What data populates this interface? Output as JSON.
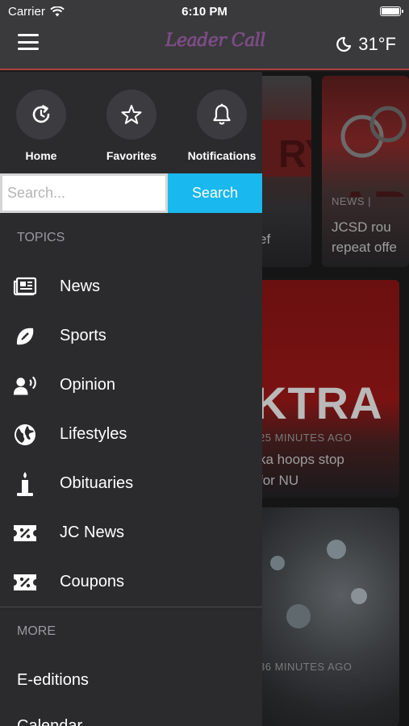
{
  "status_bar": {
    "carrier": "Carrier",
    "time": "6:10 PM"
  },
  "header": {
    "logo_text": "Leader Call",
    "temperature": "31°F",
    "weather_icon": "moon-icon"
  },
  "quick_links": [
    {
      "label": "Home",
      "icon": "refresh-clock-icon"
    },
    {
      "label": "Favorites",
      "icon": "star-icon"
    },
    {
      "label": "Notifications",
      "icon": "bell-icon"
    }
  ],
  "search": {
    "placeholder": "Search...",
    "value": "",
    "button_label": "Search"
  },
  "topics_heading": "TOPICS",
  "topics": [
    {
      "label": "News",
      "icon": "newspaper-icon"
    },
    {
      "label": "Sports",
      "icon": "football-icon"
    },
    {
      "label": "Opinion",
      "icon": "speaking-person-icon"
    },
    {
      "label": "Lifestyles",
      "icon": "globe-icon"
    },
    {
      "label": "Obituaries",
      "icon": "candle-icon"
    },
    {
      "label": "JC News",
      "icon": "coupon-icon"
    },
    {
      "label": "Coupons",
      "icon": "coupon-icon"
    }
  ],
  "more_heading": "MORE",
  "more_items": [
    {
      "label": "E-editions"
    },
    {
      "label": "Calendar"
    }
  ],
  "feed": {
    "card1": {
      "fragment": "ef"
    },
    "card2": {
      "meta": "NEWS |",
      "text_line1": "JCSD rou",
      "text_line2": "repeat offe"
    },
    "card3": {
      "meta": "25 MINUTES AGO",
      "text_line1": "ka hoops stop",
      "text_line2": "for NU",
      "banner": "KTRA"
    },
    "card4": {
      "meta": "36 MINUTES AGO"
    }
  },
  "colors": {
    "accent": "#19b8ee",
    "nav_border": "#b0413e",
    "drawer_bg": "#2b2b2e"
  }
}
